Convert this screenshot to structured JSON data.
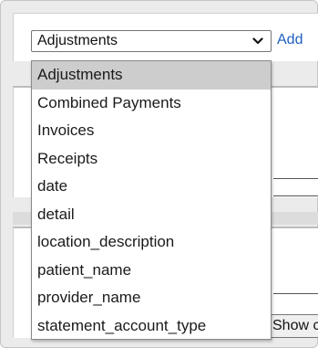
{
  "report_select": {
    "selected_value": "Adjustments",
    "options": [
      "Adjustments",
      "Combined Payments",
      "Invoices",
      "Receipts",
      "date",
      "detail",
      "location_description",
      "patient_name",
      "provider_name",
      "statement_account_type"
    ],
    "icon": "chevron-down-icon"
  },
  "add_link": "Add",
  "show_button": "Show c",
  "colors": {
    "link": "#1f5fbf",
    "selected_option_bg": "#cdcdcd",
    "panel_bg": "#ebebeb"
  }
}
